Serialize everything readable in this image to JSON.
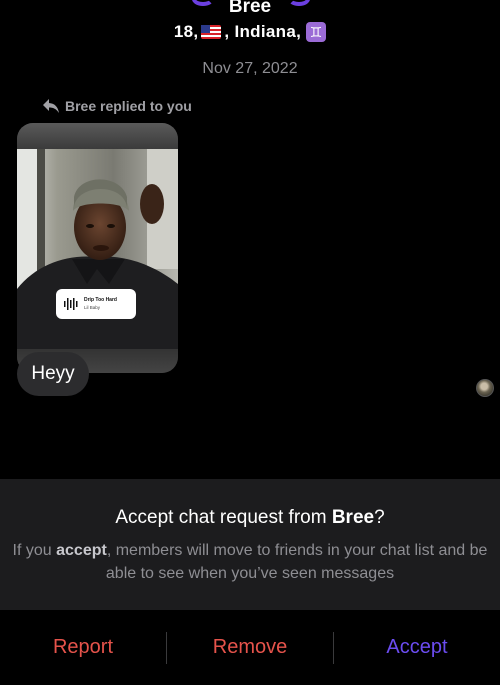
{
  "header": {
    "name": "Bree",
    "age": "18,",
    "location": ", Indiana,",
    "flag_icon": "us-flag",
    "zodiac_icon": "gemini",
    "zodiac_glyph": "♊"
  },
  "chat": {
    "date": "Nov 27, 2022",
    "reply_note": "Bree replied to you",
    "music": {
      "title": "Drip Too Hard",
      "artist": "Lil Baby"
    },
    "message": "Heyy"
  },
  "request": {
    "title_prefix": "Accept chat request from ",
    "title_name": "Bree",
    "title_suffix": "?",
    "desc_prefix": "If you ",
    "desc_bold": "accept",
    "desc_suffix": ", members will move to friends in your chat list and be able to see when you’ve seen messages"
  },
  "actions": {
    "report": "Report",
    "remove": "Remove",
    "accept": "Accept"
  },
  "colors": {
    "accent": "#6b4cf0",
    "danger": "#e5534b",
    "panel": "#1c1c1e"
  }
}
